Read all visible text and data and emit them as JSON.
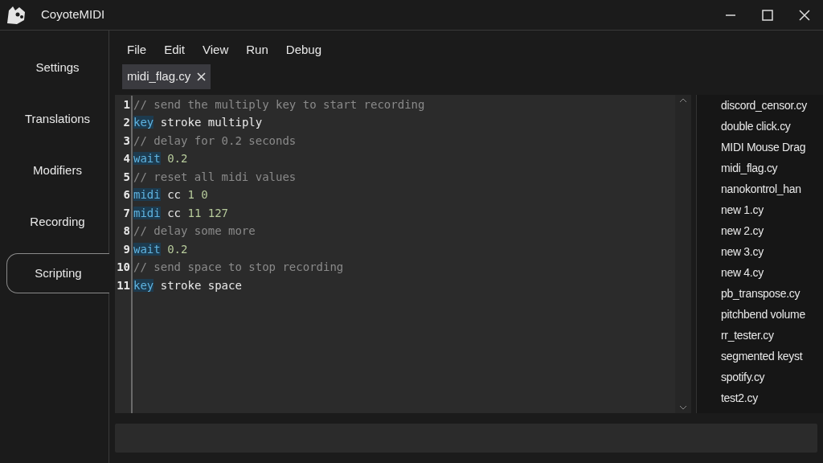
{
  "window": {
    "title": "CoyoteMIDI"
  },
  "sidebar": {
    "items": [
      {
        "label": "Settings",
        "selected": false
      },
      {
        "label": "Translations",
        "selected": false
      },
      {
        "label": "Modifiers",
        "selected": false
      },
      {
        "label": "Recording",
        "selected": false
      },
      {
        "label": "Scripting",
        "selected": true
      }
    ]
  },
  "menu": [
    "File",
    "Edit",
    "View",
    "Run",
    "Debug"
  ],
  "tabs": [
    {
      "label": "midi_flag.cy",
      "selected": true
    }
  ],
  "editor": {
    "lines": [
      {
        "number": "1",
        "tokens": [
          {
            "kind": "comment",
            "text": "// send the multiply key to start recording"
          }
        ]
      },
      {
        "number": "2",
        "tokens": [
          {
            "kind": "keyword",
            "text": "key"
          },
          {
            "kind": "plain",
            "text": "stroke multiply"
          }
        ]
      },
      {
        "number": "3",
        "tokens": [
          {
            "kind": "comment",
            "text": "// delay for 0.2 seconds"
          }
        ]
      },
      {
        "number": "4",
        "tokens": [
          {
            "kind": "keyword",
            "text": "wait"
          },
          {
            "kind": "number",
            "text": "0.2"
          }
        ]
      },
      {
        "number": "5",
        "tokens": [
          {
            "kind": "comment",
            "text": "// reset all midi values"
          }
        ]
      },
      {
        "number": "6",
        "tokens": [
          {
            "kind": "keyword",
            "text": "midi"
          },
          {
            "kind": "plain",
            "text": "cc"
          },
          {
            "kind": "number",
            "text": "1 0"
          }
        ]
      },
      {
        "number": "7",
        "tokens": [
          {
            "kind": "keyword",
            "text": "midi"
          },
          {
            "kind": "plain",
            "text": "cc"
          },
          {
            "kind": "number",
            "text": "11 127"
          }
        ]
      },
      {
        "number": "8",
        "tokens": [
          {
            "kind": "comment",
            "text": "// delay some more"
          }
        ]
      },
      {
        "number": "9",
        "tokens": [
          {
            "kind": "keyword",
            "text": "wait"
          },
          {
            "kind": "number",
            "text": "0.2"
          }
        ]
      },
      {
        "number": "10",
        "tokens": [
          {
            "kind": "comment",
            "text": "// send space to stop recording"
          }
        ]
      },
      {
        "number": "11",
        "tokens": [
          {
            "kind": "keyword",
            "text": "key"
          },
          {
            "kind": "plain",
            "text": "stroke space"
          }
        ]
      }
    ]
  },
  "files": [
    "discord_censor.cy",
    "double click.cy",
    "MIDI Mouse Drag",
    "midi_flag.cy",
    "nanokontrol_han",
    "new 1.cy",
    "new 2.cy",
    "new 3.cy",
    "new 4.cy",
    "pb_transpose.cy",
    "pitchbend volume",
    "rr_tester.cy",
    "segmented keyst",
    "spotify.cy",
    "test2.cy"
  ]
}
